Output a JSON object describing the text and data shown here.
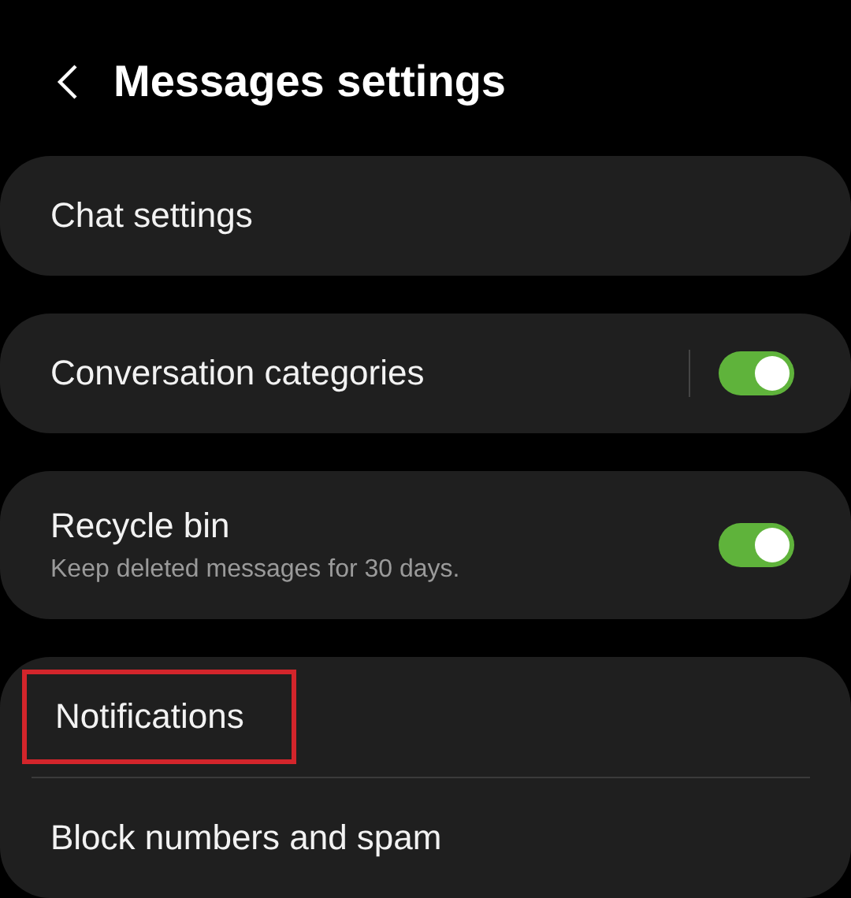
{
  "header": {
    "title": "Messages settings"
  },
  "sections": [
    {
      "items": [
        {
          "kind": "link",
          "label": "Chat settings",
          "highlighted": false
        }
      ]
    },
    {
      "items": [
        {
          "kind": "toggle",
          "label": "Conversation categories",
          "on": true,
          "split": true,
          "highlighted": false
        }
      ]
    },
    {
      "items": [
        {
          "kind": "toggle",
          "label": "Recycle bin",
          "summary": "Keep deleted messages for 30 days.",
          "on": true,
          "split": false,
          "highlighted": false
        }
      ]
    },
    {
      "items": [
        {
          "kind": "link",
          "label": "Notifications",
          "highlighted": true
        },
        {
          "kind": "link",
          "label": "Block numbers and spam",
          "highlighted": false
        }
      ]
    }
  ]
}
